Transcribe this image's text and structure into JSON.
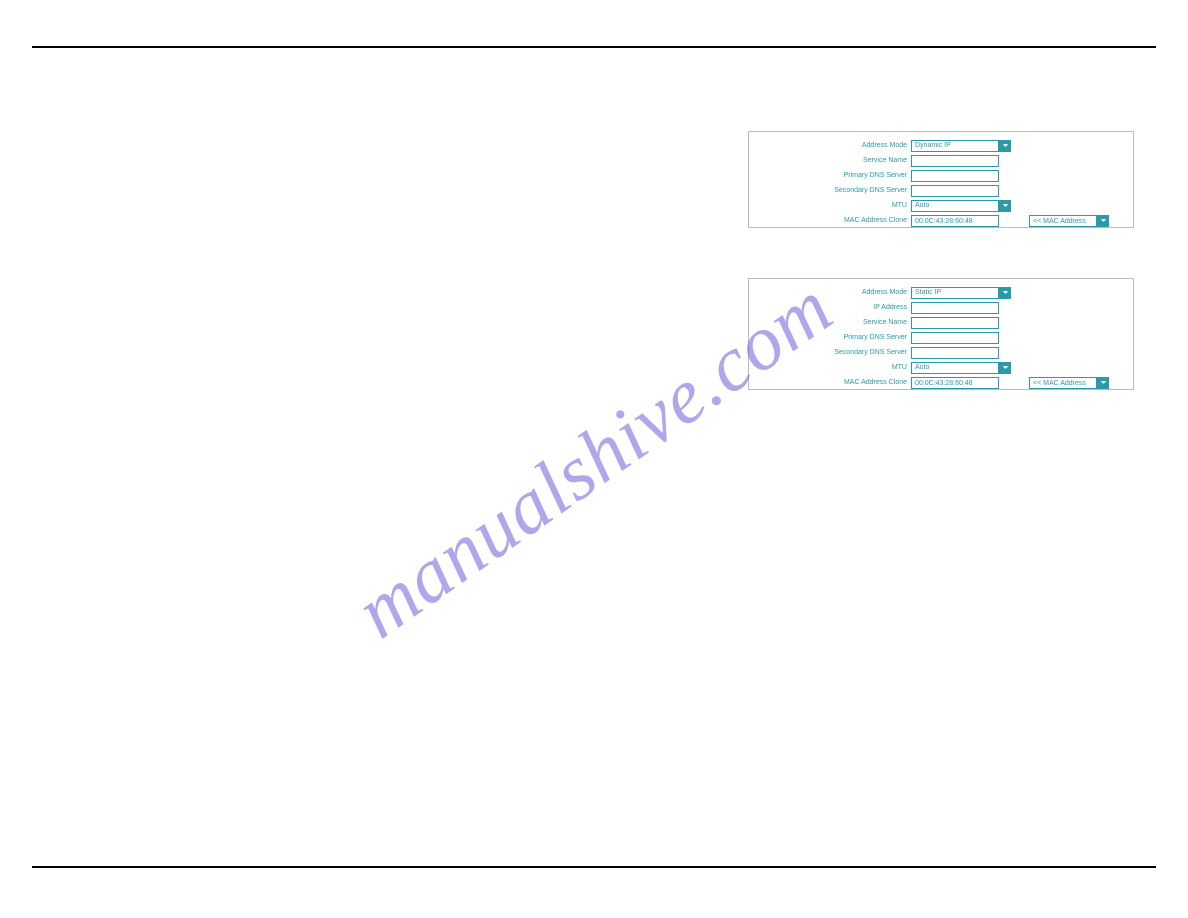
{
  "watermark": "manualshive.com",
  "panel1": {
    "rows": [
      {
        "label": "Address Mode",
        "type": "select",
        "value": "Dynamic IP"
      },
      {
        "label": "Service Name",
        "type": "text",
        "value": ""
      },
      {
        "label": "Primary DNS Server",
        "type": "text",
        "value": ""
      },
      {
        "label": "Secondary DNS Server",
        "type": "text",
        "value": ""
      },
      {
        "label": "MTU",
        "type": "select",
        "value": "Auto"
      },
      {
        "label": "MAC Address Clone",
        "type": "macrow",
        "value": "00:0C:43:28:60:48",
        "sidelabel": "<< MAC Address"
      }
    ]
  },
  "panel2": {
    "rows": [
      {
        "label": "Address Mode",
        "type": "select",
        "value": "Static IP"
      },
      {
        "label": "IP Address",
        "type": "text",
        "value": ""
      },
      {
        "label": "Service Name",
        "type": "text",
        "value": ""
      },
      {
        "label": "Primary DNS Server",
        "type": "text",
        "value": ""
      },
      {
        "label": "Secondary DNS Server",
        "type": "text",
        "value": ""
      },
      {
        "label": "MTU",
        "type": "select",
        "value": "Auto"
      },
      {
        "label": "MAC Address Clone",
        "type": "macrow",
        "value": "00:0C:43:28:60:48",
        "sidelabel": "<< MAC Address"
      }
    ]
  }
}
